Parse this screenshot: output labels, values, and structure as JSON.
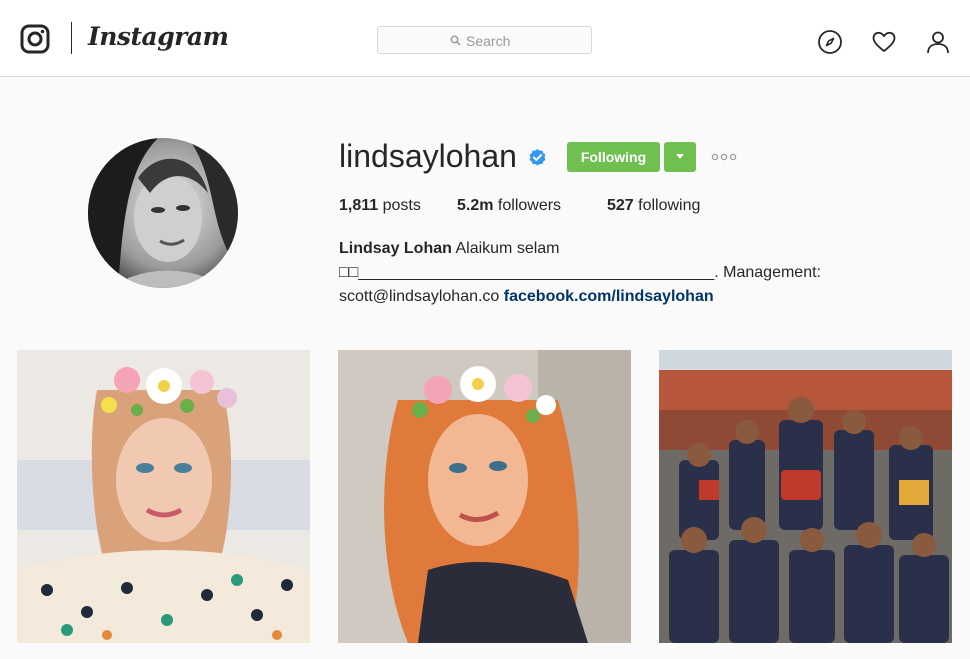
{
  "brand": {
    "wordmark": "Instagram",
    "logo_icon": "instagram-camera-icon"
  },
  "search": {
    "placeholder": "Search",
    "icon": "search-icon"
  },
  "nav": {
    "icons": [
      "compass-icon",
      "heart-icon",
      "person-icon"
    ]
  },
  "profile": {
    "username": "lindsaylohan",
    "verified_icon": "verified-badge-icon",
    "follow_button": "Following",
    "dropdown_icon": "caret-down-icon",
    "more_icon": "ellipsis-icon",
    "stats": {
      "posts_count": "1,811",
      "posts_label": " posts",
      "followers_count": "5.2m",
      "followers_label": " followers",
      "following_count": "527",
      "following_label": " following"
    },
    "bio": {
      "full_name": "Lindsay Lohan",
      "line1_text": " Alaikum selam",
      "line2_text": "□□________________________________________. Management:",
      "email": "scott@lindsaylohan.co",
      "link": "facebook.com/lindsaylohan"
    }
  },
  "colors": {
    "follow_green": "#70c050",
    "link_blue": "#003569",
    "verified_blue": "#3897f0",
    "border": "#dbdbdb"
  },
  "posts": [
    {
      "alt": ""
    },
    {
      "alt": ""
    },
    {
      "alt": ""
    }
  ]
}
